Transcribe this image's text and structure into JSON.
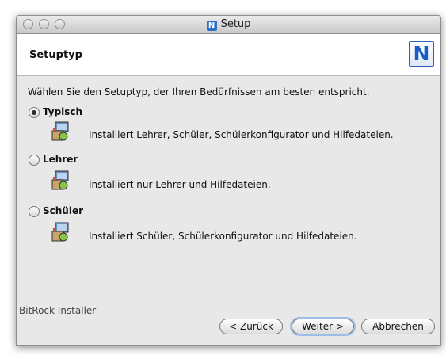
{
  "window": {
    "title": "Setup",
    "title_icon_letter": "N"
  },
  "header": {
    "title": "Setuptyp",
    "logo_letter": "N"
  },
  "main": {
    "description": "Wählen Sie den Setuptyp, der Ihren Bedürfnissen am besten entspricht.",
    "options": [
      {
        "label": "Typisch",
        "selected": true,
        "description": "Installiert Lehrer, Schüler, Schülerkonfigurator und Hilfedateien."
      },
      {
        "label": "Lehrer",
        "selected": false,
        "description": "Installiert nur Lehrer und Hilfedateien."
      },
      {
        "label": "Schüler",
        "selected": false,
        "description": "Installiert Schüler, Schülerkonfigurator und Hilfedateien."
      }
    ]
  },
  "footer": {
    "installer_label": "BitRock Installer",
    "back_label": "< Zurück",
    "next_label": "Weiter >",
    "cancel_label": "Abbrechen"
  },
  "colors": {
    "accent": "#1b5bc6",
    "window_bg": "#e8e8e8"
  }
}
